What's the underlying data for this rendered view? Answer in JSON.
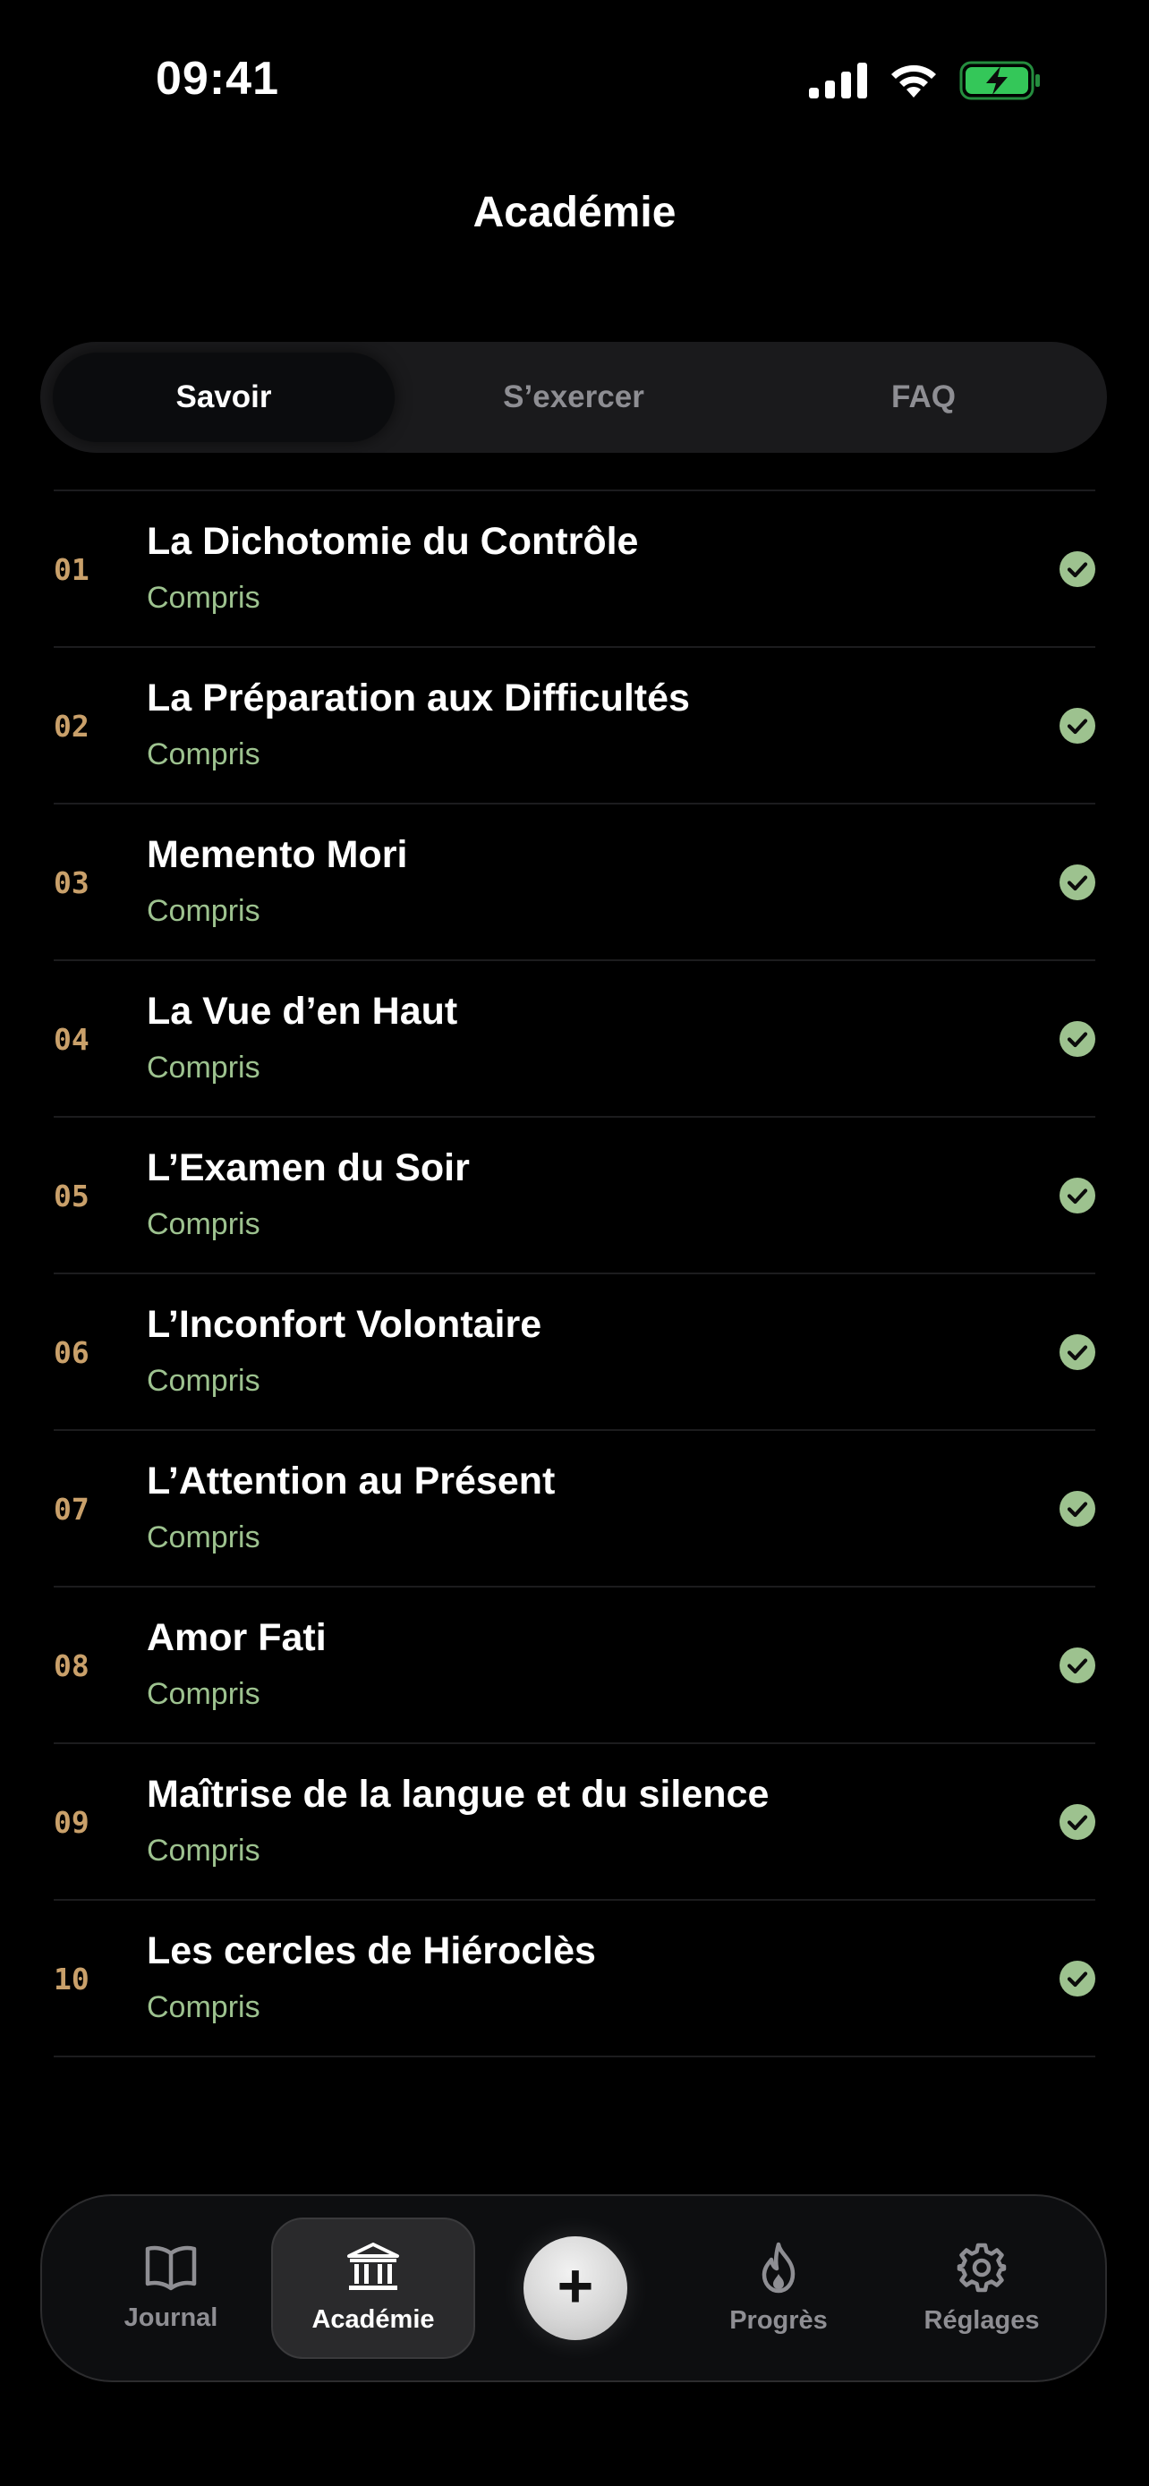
{
  "status_bar": {
    "time": "09:41"
  },
  "header": {
    "title": "Académie"
  },
  "segments": [
    {
      "label": "Savoir",
      "active": true
    },
    {
      "label": "S’exercer",
      "active": false
    },
    {
      "label": "FAQ",
      "active": false
    }
  ],
  "lessons": [
    {
      "number": "01",
      "title": "La Dichotomie du Contrôle",
      "status": "Compris"
    },
    {
      "number": "02",
      "title": "La Préparation aux Difficultés",
      "status": "Compris"
    },
    {
      "number": "03",
      "title": "Memento Mori",
      "status": "Compris"
    },
    {
      "number": "04",
      "title": "La Vue d’en Haut",
      "status": "Compris"
    },
    {
      "number": "05",
      "title": "L’Examen du Soir",
      "status": "Compris"
    },
    {
      "number": "06",
      "title": "L’Inconfort Volontaire",
      "status": "Compris"
    },
    {
      "number": "07",
      "title": "L’Attention au Présent",
      "status": "Compris"
    },
    {
      "number": "08",
      "title": "Amor Fati",
      "status": "Compris"
    },
    {
      "number": "09",
      "title": "Maîtrise de la langue et du silence",
      "status": "Compris"
    },
    {
      "number": "10",
      "title": "Les cercles de Hiéroclès",
      "status": "Compris"
    }
  ],
  "tab_bar": {
    "journal": {
      "label": "Journal",
      "icon": "book-icon"
    },
    "academie": {
      "label": "Académie",
      "icon": "institution-icon"
    },
    "add": {
      "label": "+",
      "icon": "plus-icon"
    },
    "progres": {
      "label": "Progrès",
      "icon": "flame-icon"
    },
    "reglages": {
      "label": "Réglages",
      "icon": "gear-icon"
    }
  },
  "colors": {
    "background": "#000000",
    "number_accent": "#c9a06a",
    "status_green": "#9dc28f",
    "check_green": "#9dc28f",
    "battery_green": "#34c759"
  }
}
